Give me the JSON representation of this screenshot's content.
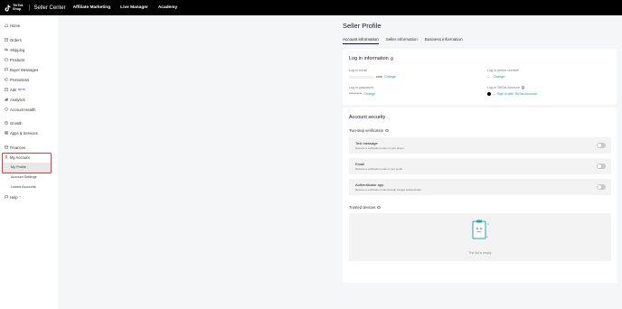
{
  "topbar": {
    "logo_line1": "TikTok",
    "logo_line2": "Shop",
    "brand": "Seller Center",
    "nav": [
      "Affiliate Marketing",
      "Live Manager",
      "Academy"
    ]
  },
  "sidebar": {
    "items": [
      {
        "label": "Home",
        "icon": "home-icon"
      },
      {
        "label": "Orders",
        "icon": "orders-icon"
      },
      {
        "label": "Shipping",
        "icon": "shipping-icon"
      },
      {
        "label": "Products",
        "icon": "products-icon"
      },
      {
        "label": "Buyer Messages",
        "icon": "messages-icon"
      },
      {
        "label": "Promotions",
        "icon": "promotions-icon"
      },
      {
        "label": "Ads",
        "icon": "ads-icon",
        "badge": "BETA"
      },
      {
        "label": "Analytics",
        "icon": "analytics-icon"
      },
      {
        "label": "Account Health",
        "icon": "health-icon"
      },
      {
        "label": "Growth",
        "icon": "growth-icon"
      },
      {
        "label": "Apps & Services",
        "icon": "apps-icon"
      },
      {
        "label": "Finances",
        "icon": "finances-icon"
      },
      {
        "label": "My Account",
        "icon": "user-icon"
      },
      {
        "label": "Help",
        "icon": "help-icon"
      }
    ],
    "sub_items": [
      "My Profile",
      "Account Settings",
      "Linked Accounts"
    ]
  },
  "main": {
    "title": "Seller Profile",
    "tabs": [
      "Account information",
      "Seller information",
      "Business information"
    ],
    "login": {
      "title": "Log in information",
      "email_label": "Log in email",
      "email_value": ".com",
      "phone_label": "Log in phone number",
      "phone_value": "--",
      "password_label": "Log in password",
      "password_value": "**********",
      "tiktok_label": "Log in TikTok Account",
      "tiktok_value": "--",
      "tiktok_link": "Sign in with TikTok Account",
      "change": "Change"
    },
    "security": {
      "title": "Account security",
      "two_step": "Two-step verification",
      "options": [
        {
          "name": "Text message",
          "desc": "Receive a verification code on your phone"
        },
        {
          "name": "Email",
          "desc": "Receive a verification code in your email"
        },
        {
          "name": "Authenticator app",
          "desc": "Receive a verification code through Google Authenticator"
        }
      ],
      "trusted": "Trusted devices",
      "empty": "The list is empty"
    }
  },
  "colors": {
    "accent": "#0f9fa8",
    "highlight": "#e5383b",
    "topbar": "#000000"
  }
}
